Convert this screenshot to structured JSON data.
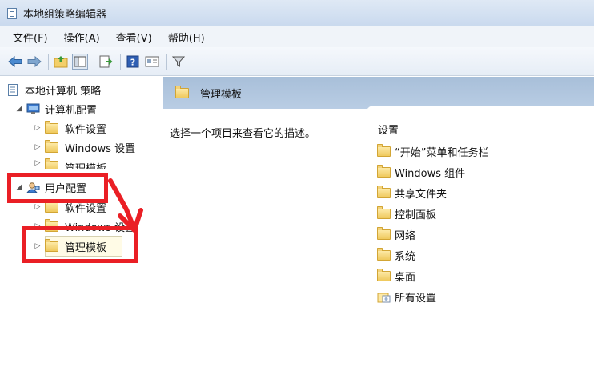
{
  "window": {
    "title": "本地组策略编辑器"
  },
  "menu": {
    "items": [
      "文件(F)",
      "操作(A)",
      "查看(V)",
      "帮助(H)"
    ]
  },
  "toolbar": {
    "icons": [
      "back-arrow-icon",
      "forward-arrow-icon",
      "up-folder-icon",
      "show-hide-tree-icon",
      "export-list-icon",
      "help-icon",
      "properties-icon",
      "filter-icon"
    ]
  },
  "tree": {
    "root": "本地计算机 策略",
    "computer_config": "计算机配置",
    "computer_children": [
      "软件设置",
      "Windows 设置",
      "管理模板"
    ],
    "user_config": "用户配置",
    "user_children": [
      "软件设置",
      "Windows 设置",
      "管理模板"
    ]
  },
  "right": {
    "header_title": "管理模板",
    "description": "选择一个项目来查看它的描述。",
    "column_header": "设置",
    "items": [
      "“开始”菜单和任务栏",
      "Windows 组件",
      "共享文件夹",
      "控制面板",
      "网络",
      "系统",
      "桌面",
      "所有设置"
    ]
  },
  "colors": {
    "annotation_red": "#ea1f25",
    "header_blue": "#a8bfd9"
  }
}
